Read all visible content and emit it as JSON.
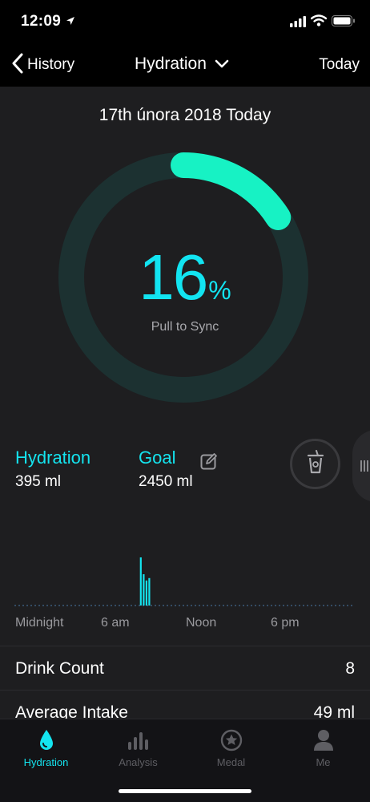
{
  "status_bar": {
    "time": "12:09"
  },
  "nav": {
    "back_label": "History",
    "title": "Hydration",
    "right_label": "Today"
  },
  "summary": {
    "date": "17th února 2018 Today",
    "percent": "16",
    "percent_unit": "%",
    "progress_fraction": 0.16,
    "sync_hint": "Pull to Sync"
  },
  "stats": {
    "hydration_label": "Hydration",
    "hydration_value": "395 ml",
    "goal_label": "Goal",
    "goal_value": "2450 ml"
  },
  "chart_data": {
    "type": "bar",
    "x_ticks": [
      "Midnight",
      "6 am",
      "Noon",
      "6 pm"
    ],
    "x_range_hours": [
      0,
      24
    ],
    "bars": [
      {
        "hour": 8.85,
        "value": 1.0
      },
      {
        "hour": 9.05,
        "value": 0.65
      },
      {
        "hour": 9.25,
        "value": 0.52
      },
      {
        "hour": 9.45,
        "value": 0.57
      }
    ],
    "baseline": "dotted"
  },
  "rows": [
    {
      "label": "Drink Count",
      "value": "8"
    },
    {
      "label": "Average Intake",
      "value": "49 ml"
    }
  ],
  "tabs": [
    {
      "label": "Hydration",
      "icon": "drop-icon",
      "active": true
    },
    {
      "label": "Analysis",
      "icon": "bars-icon",
      "active": false
    },
    {
      "label": "Medal",
      "icon": "medal-icon",
      "active": false
    },
    {
      "label": "Me",
      "icon": "person-icon",
      "active": false
    }
  ],
  "colors": {
    "accent": "#14e4ef",
    "progress": "#17f2c4",
    "ring_track": "#1c3131",
    "background": "#1e1e20"
  }
}
